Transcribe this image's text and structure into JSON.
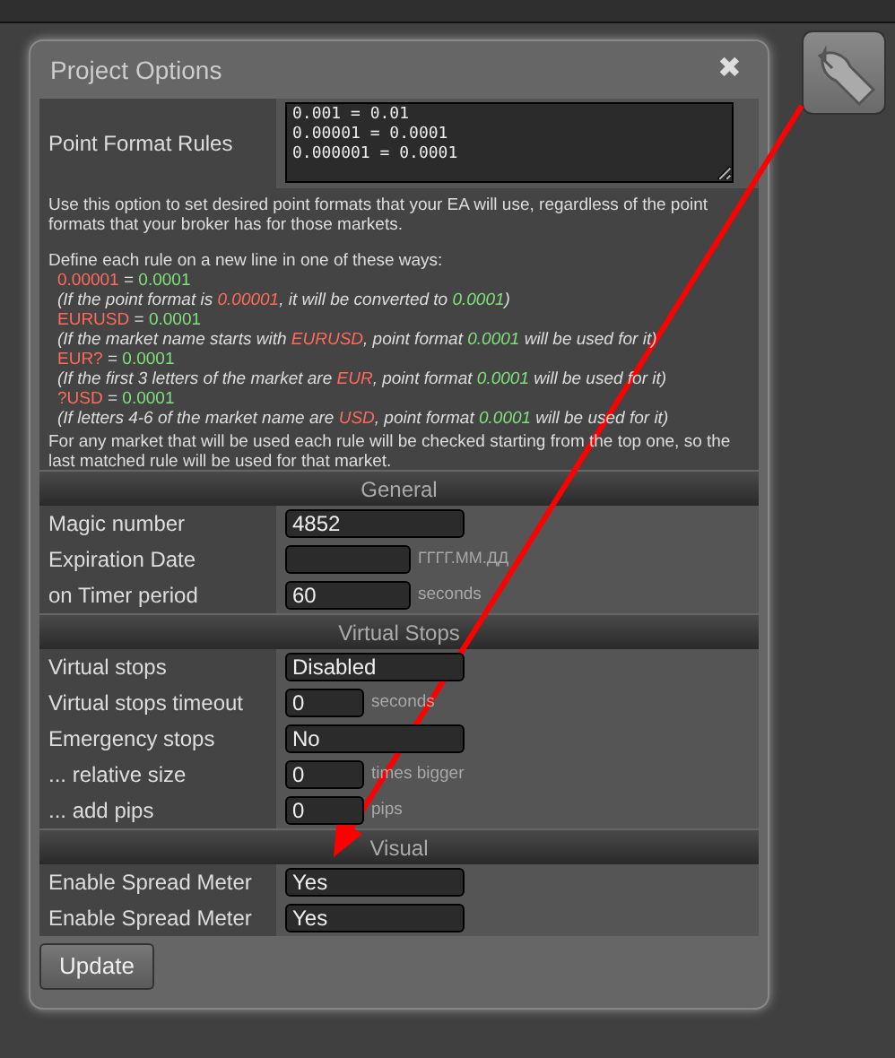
{
  "dialog": {
    "title": "Project Options",
    "close": "✖"
  },
  "point_format": {
    "label": "Point Format Rules",
    "value": "0.001 = 0.01\n0.00001 = 0.0001\n0.000001 = 0.0001"
  },
  "help": [
    {
      "kind": "para",
      "parts": [
        {
          "color": "#dddddd",
          "text": "Use this option to set desired point formats that your EA will use, regardless of the point formats that your broker has for those markets."
        }
      ]
    },
    {
      "kind": "para",
      "parts": [
        {
          "color": "#dddddd",
          "text": "Define each rule on a new line in one of these ways:"
        }
      ]
    },
    {
      "kind": "rule",
      "parts": [
        {
          "color": "#ff6a5a",
          "text": "0.00001"
        },
        {
          "color": "#dddddd",
          "text": " = "
        },
        {
          "color": "#7fe07a",
          "text": "0.0001"
        }
      ]
    },
    {
      "kind": "note",
      "parts": [
        {
          "color": "#dddddd",
          "text": "(If the point format is "
        },
        {
          "color": "#ff6a5a",
          "text": "0.00001"
        },
        {
          "color": "#dddddd",
          "text": ", it will be converted to "
        },
        {
          "color": "#7fe07a",
          "text": "0.0001"
        },
        {
          "color": "#dddddd",
          "text": ")"
        }
      ]
    },
    {
      "kind": "rule",
      "parts": [
        {
          "color": "#ff6a5a",
          "text": "EURUSD"
        },
        {
          "color": "#dddddd",
          "text": " = "
        },
        {
          "color": "#7fe07a",
          "text": "0.0001"
        }
      ]
    },
    {
      "kind": "note",
      "parts": [
        {
          "color": "#dddddd",
          "text": "(If the market name starts with "
        },
        {
          "color": "#ff6a5a",
          "text": "EURUSD"
        },
        {
          "color": "#dddddd",
          "text": ", point format "
        },
        {
          "color": "#7fe07a",
          "text": "0.0001"
        },
        {
          "color": "#dddddd",
          "text": " will be used for it)"
        }
      ]
    },
    {
      "kind": "rule",
      "parts": [
        {
          "color": "#ff6a5a",
          "text": "EUR?"
        },
        {
          "color": "#dddddd",
          "text": " = "
        },
        {
          "color": "#7fe07a",
          "text": "0.0001"
        }
      ]
    },
    {
      "kind": "note",
      "parts": [
        {
          "color": "#dddddd",
          "text": "(If the first 3 letters of the market are "
        },
        {
          "color": "#ff6a5a",
          "text": "EUR"
        },
        {
          "color": "#dddddd",
          "text": ", point format "
        },
        {
          "color": "#7fe07a",
          "text": "0.0001"
        },
        {
          "color": "#dddddd",
          "text": " will be used for it)"
        }
      ]
    },
    {
      "kind": "rule",
      "parts": [
        {
          "color": "#ff6a5a",
          "text": "?USD"
        },
        {
          "color": "#dddddd",
          "text": " = "
        },
        {
          "color": "#7fe07a",
          "text": "0.0001"
        }
      ]
    },
    {
      "kind": "note",
      "parts": [
        {
          "color": "#dddddd",
          "text": "(If letters 4-6 of the market name are "
        },
        {
          "color": "#ff6a5a",
          "text": "USD"
        },
        {
          "color": "#dddddd",
          "text": ", point format "
        },
        {
          "color": "#7fe07a",
          "text": "0.0001"
        },
        {
          "color": "#dddddd",
          "text": " will be used for it)"
        }
      ]
    },
    {
      "kind": "para",
      "parts": [
        {
          "color": "#dddddd",
          "text": "For any market that will be used each rule will be checked starting from the top one, so the last matched rule will be used for that market."
        }
      ]
    }
  ],
  "sections": [
    {
      "title": "General",
      "rows": [
        {
          "label": "Magic number",
          "kind": "wide",
          "value": "4852"
        },
        {
          "label": "Expiration Date",
          "kind": "medium",
          "placeholder": "ГГГГ.ММ.ДД"
        },
        {
          "label": "on Timer period",
          "kind": "medium",
          "value": "60",
          "unit": "seconds"
        }
      ]
    },
    {
      "title": "Virtual Stops",
      "rows": [
        {
          "label": "Virtual stops",
          "kind": "wide",
          "value": "Disabled"
        },
        {
          "label": "Virtual stops timeout",
          "kind": "short",
          "value": "0",
          "unit": "seconds"
        },
        {
          "label": "Emergency stops",
          "kind": "wide",
          "value": "No"
        },
        {
          "label": "... relative size",
          "kind": "short",
          "value": "0",
          "unit": "times bigger"
        },
        {
          "label": "... add pips",
          "kind": "short",
          "value": "0",
          "unit": "pips"
        }
      ]
    },
    {
      "title": "Visual",
      "rows": [
        {
          "label": "Enable Spread Meter",
          "kind": "wide",
          "value": "Yes"
        },
        {
          "label": "Enable Spread Meter",
          "kind": "wide",
          "value": "Yes"
        }
      ]
    }
  ],
  "update_button": "Update"
}
